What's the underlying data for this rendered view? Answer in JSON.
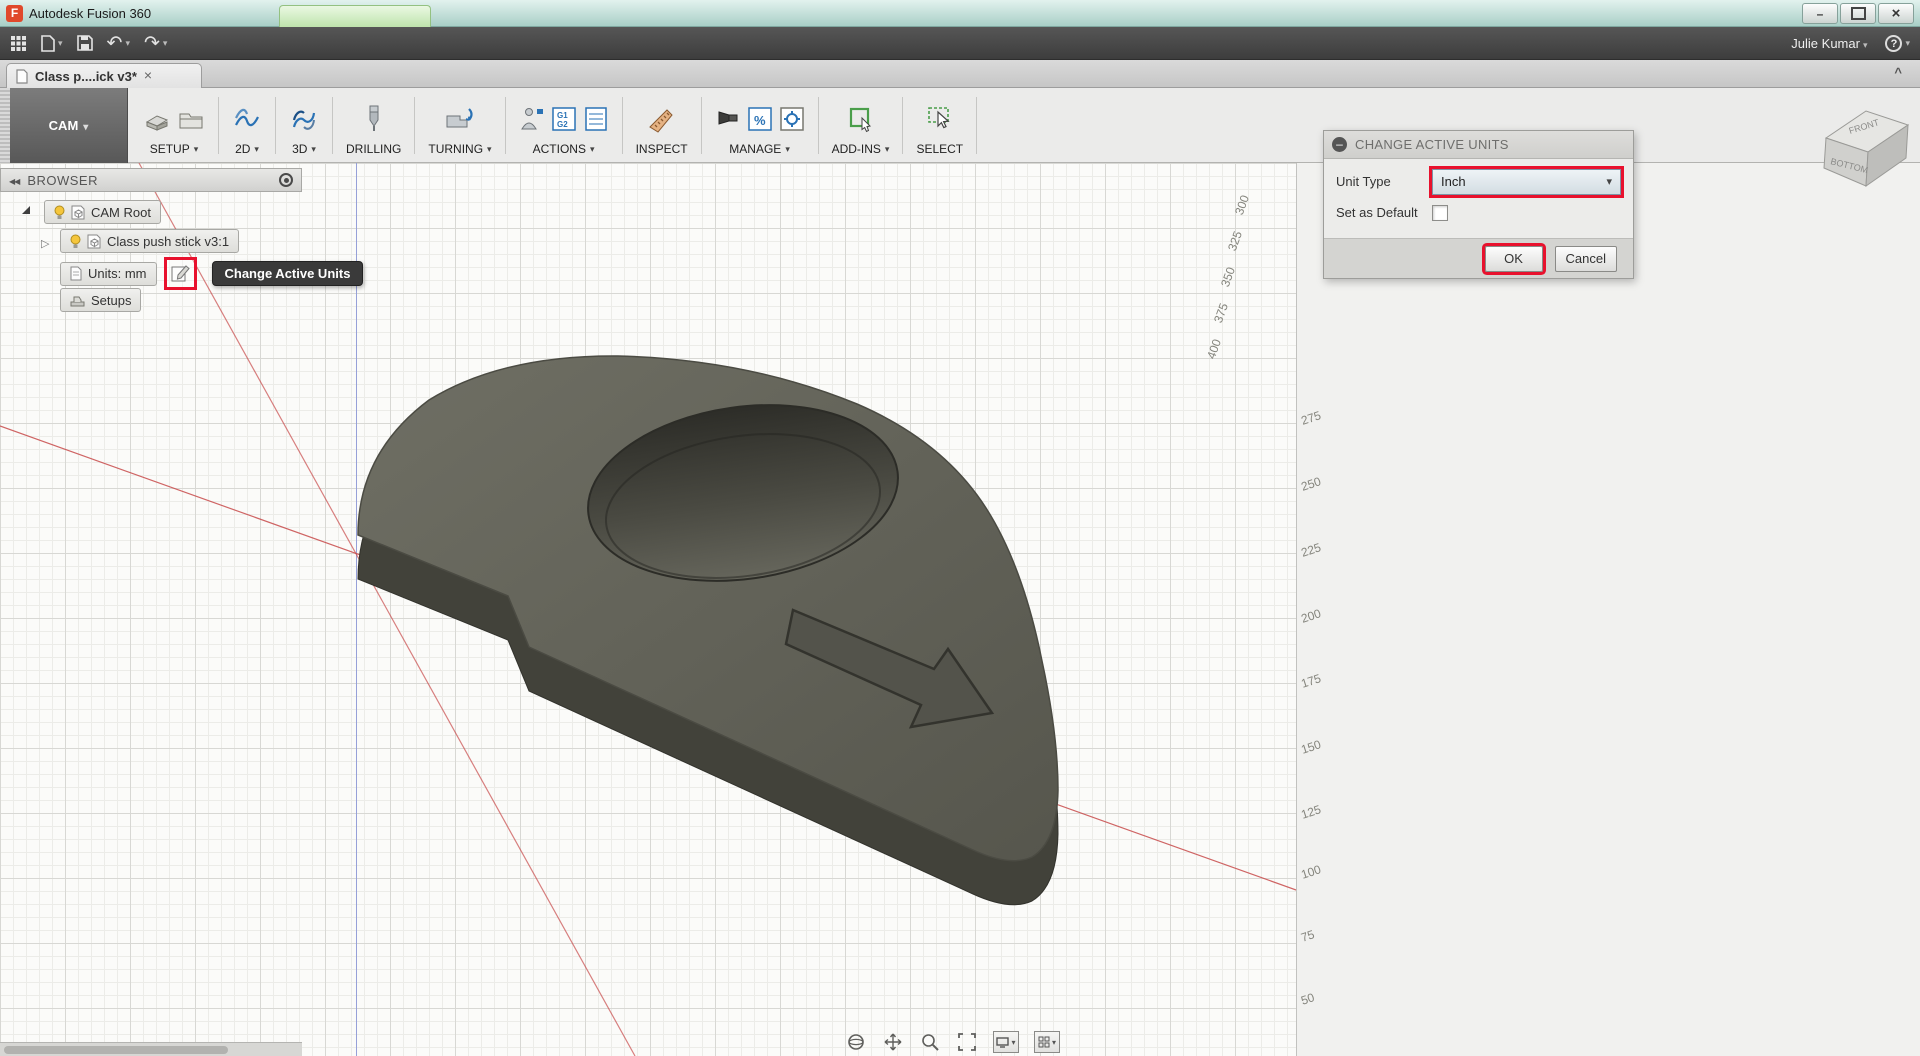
{
  "window": {
    "title": "Autodesk Fusion 360"
  },
  "app_bar": {
    "user_name": "Julie Kumar",
    "help_label": "?"
  },
  "tabs": {
    "document": {
      "label": "Class p....ick v3*"
    }
  },
  "ribbon": {
    "workspace_label": "CAM",
    "gcode_lines": [
      "G1",
      "G2"
    ],
    "percent_text": "%",
    "groups": [
      {
        "label": "SETUP",
        "dropdown": true
      },
      {
        "label": "2D",
        "dropdown": true
      },
      {
        "label": "3D",
        "dropdown": true
      },
      {
        "label": "DRILLING",
        "dropdown": false
      },
      {
        "label": "TURNING",
        "dropdown": true
      },
      {
        "label": "ACTIONS",
        "dropdown": true
      },
      {
        "label": "INSPECT",
        "dropdown": false
      },
      {
        "label": "MANAGE",
        "dropdown": true
      },
      {
        "label": "ADD-INS",
        "dropdown": true
      },
      {
        "label": "SELECT",
        "dropdown": false
      }
    ]
  },
  "browser": {
    "header": "BROWSER",
    "items": [
      {
        "label": "CAM Root"
      },
      {
        "label": "Class push stick v3:1"
      },
      {
        "label": "Units: mm"
      },
      {
        "label": "Setups"
      }
    ],
    "tooltip": "Change Active Units"
  },
  "dialog": {
    "title": "CHANGE ACTIVE UNITS",
    "unit_type_label": "Unit Type",
    "unit_type_value": "Inch",
    "set_default_label": "Set as Default",
    "ok_label": "OK",
    "cancel_label": "Cancel"
  },
  "viewcube": {
    "front_label": "FRONT",
    "bottom_label": "BOTTOM"
  },
  "canvas": {
    "axis_labels_right": [
      "275",
      "250",
      "225",
      "200",
      "175",
      "150",
      "125",
      "100",
      "75",
      "50"
    ],
    "axis_labels_top": [
      "300",
      "325",
      "350",
      "375",
      "400"
    ]
  },
  "colors": {
    "highlight_red": "#e8112d",
    "accent_blue": "#2a72b5",
    "model_top": "#64645a",
    "model_side": "#42423a",
    "titlebar_green": "#a9cfc7"
  }
}
